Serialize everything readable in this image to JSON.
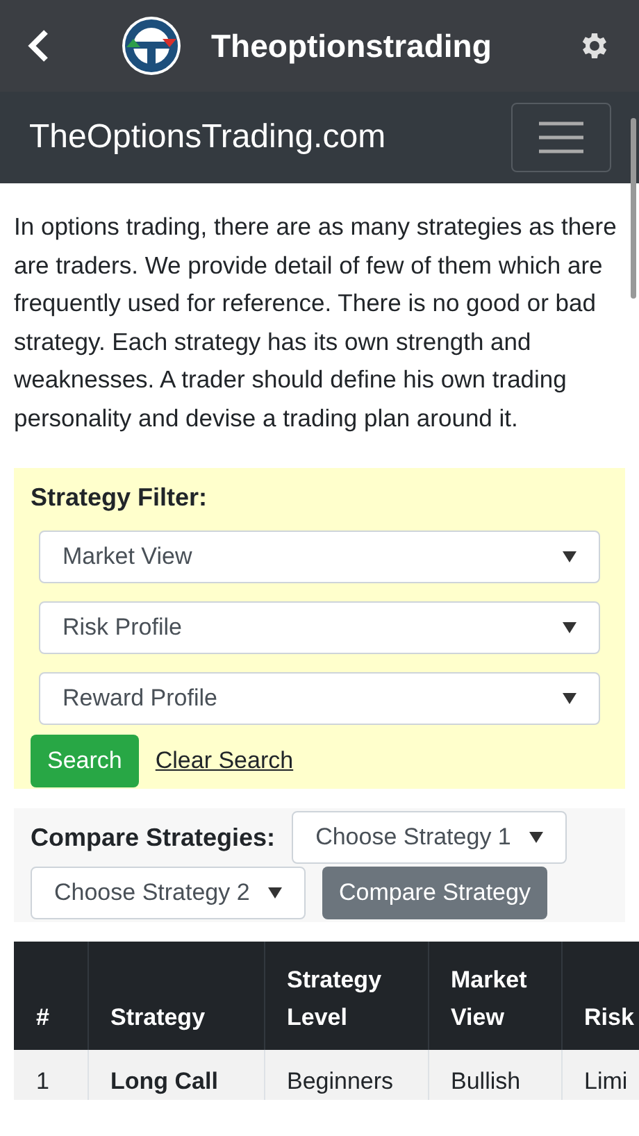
{
  "app_bar": {
    "title": "Theoptionstrading"
  },
  "navbar": {
    "brand": "TheOptionsTrading.com"
  },
  "intro": "In options trading, there are as many strategies as there are traders. We provide detail of few of them which are frequently used for reference. There is no good or bad strategy. Each strategy has its own strength and weaknesses. A trader should define his own trading personality and devise a trading plan around it.",
  "filter": {
    "title": "Strategy Filter:",
    "selects": [
      "Market View",
      "Risk Profile",
      "Reward Profile"
    ],
    "search_button": "Search",
    "clear_link": "Clear Search"
  },
  "compare": {
    "title": "Compare Strategies:",
    "select_1": "Choose Strategy 1",
    "select_2": "Choose Strategy 2",
    "button": "Compare Strategy"
  },
  "table": {
    "columns": [
      "#",
      "Strategy",
      "Strategy Level",
      "Market View",
      "Risk"
    ],
    "rows": [
      [
        "1",
        "Long Call",
        "Beginners",
        "Bullish",
        "Limi"
      ]
    ]
  }
}
